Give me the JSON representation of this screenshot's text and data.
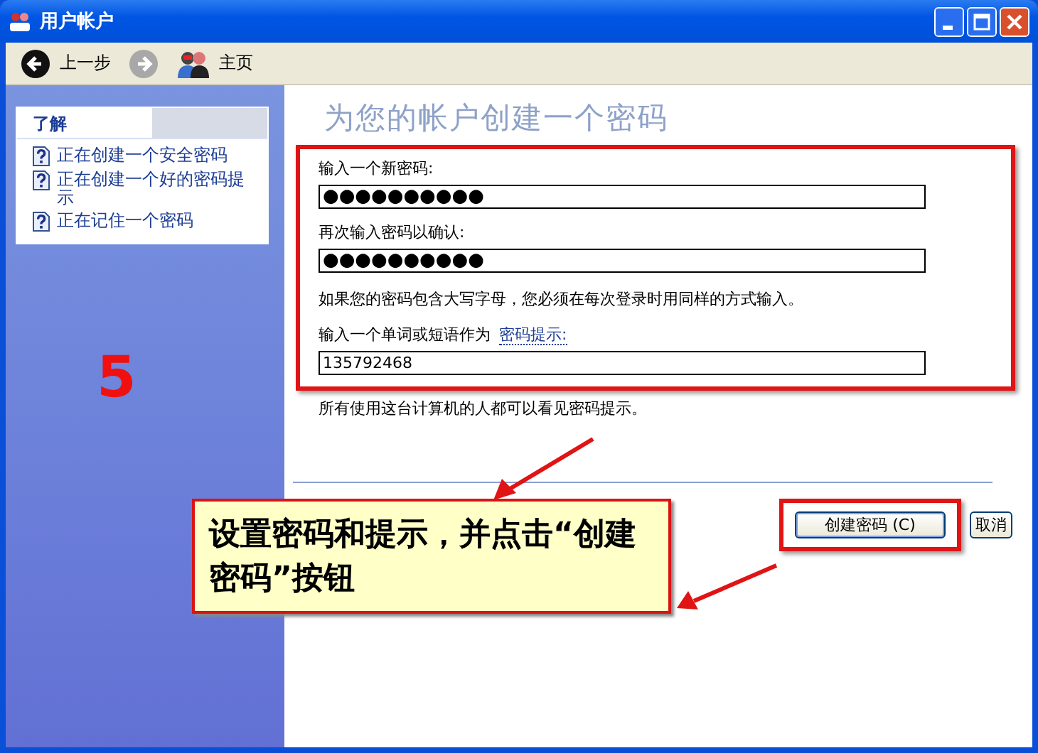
{
  "window": {
    "title": "用户帐户"
  },
  "toolbar": [
    {
      "kind": "back",
      "label": "上一步",
      "disabled": false
    },
    {
      "kind": "forward",
      "disabled": true
    },
    {
      "kind": "home",
      "label": "主页",
      "disabled": false
    }
  ],
  "sidebar": {
    "title": "了解",
    "items": [
      "正在创建一个安全密码",
      "正在创建一个好的密码提示",
      "正在记住一个密码"
    ]
  },
  "heading": "为您的帐户创建一个密码",
  "fields": [
    {
      "label": "输入一个新密码:",
      "value": "●●●●●●●●●●",
      "kind": "password"
    },
    {
      "label": "再次输入密码以确认:",
      "value": "●●●●●●●●●●",
      "kind": "password"
    }
  ],
  "note": "如果您的密码包含大写字母，您必须在每次登录时用同样的方式输入。",
  "hint": {
    "label": "输入一个单词或短语作为",
    "link": "密码提示:",
    "value": "135792468"
  },
  "footer_note": "所有使用这台计算机的人都可以看见密码提示。",
  "buttons": [
    "创建密码 (C)",
    "取消"
  ],
  "annotations": {
    "step": "5",
    "callout": "设置密码和提示，并点击“创建密码”按钮"
  }
}
